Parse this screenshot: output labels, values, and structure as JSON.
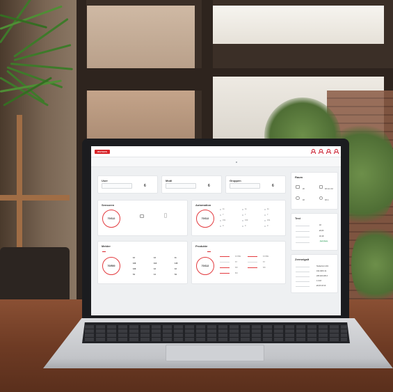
{
  "app": {
    "brand": "WAYERS"
  },
  "cards": {
    "user": {
      "title": "User",
      "value": "6"
    },
    "modi": {
      "title": "Modi",
      "value": "6"
    },
    "gruppen": {
      "title": "Gruppen",
      "value": "6"
    },
    "sensoren": {
      "title": "Sensoren",
      "ring_value": "70/112"
    },
    "automation": {
      "title": "Automation",
      "ring_value": "70/112",
      "stats": [
        "11",
        "11",
        "11",
        "7",
        "7",
        "7",
        "151",
        "150",
        "151",
        "0",
        "0",
        "0"
      ]
    },
    "melder": {
      "title": "Melder",
      "ring_value": "70/500",
      "stats": [
        "12",
        "13",
        "11",
        "123",
        "112",
        "145",
        "123",
        "13",
        "12",
        "54",
        "14",
        "54"
      ]
    },
    "produkte": {
      "title": "Produkte",
      "ring_value": "70/112",
      "values": [
        "67/789",
        "67/789",
        "67",
        "67",
        "5/5",
        "5/5",
        "8/4"
      ]
    },
    "raum": {
      "title": "Raum",
      "v1": "20",
      "v2": "18 mm 3:2",
      "v3": "18",
      "v4": "18 m"
    },
    "test": {
      "title": "Test",
      "rows": [
        {
          "v": "18"
        },
        {
          "v": "£9,63"
        },
        {
          "v": "18,18"
        }
      ],
      "status": "Sehr Rank"
    },
    "zertifikat": {
      "title": "Zermeigalt",
      "rows": [
        {
          "v": "Tackertonn 201"
        },
        {
          "v": "192.168.0.11"
        },
        {
          "v": "205.203.205.3"
        },
        {
          "v": "1.0.18"
        },
        {
          "v": "£9,63 18:10"
        }
      ]
    }
  },
  "colors": {
    "accent": "#d8262b",
    "success": "#2e9b57"
  },
  "icons": [
    "user-icon",
    "bell-icon",
    "settings-icon",
    "logout-icon"
  ]
}
